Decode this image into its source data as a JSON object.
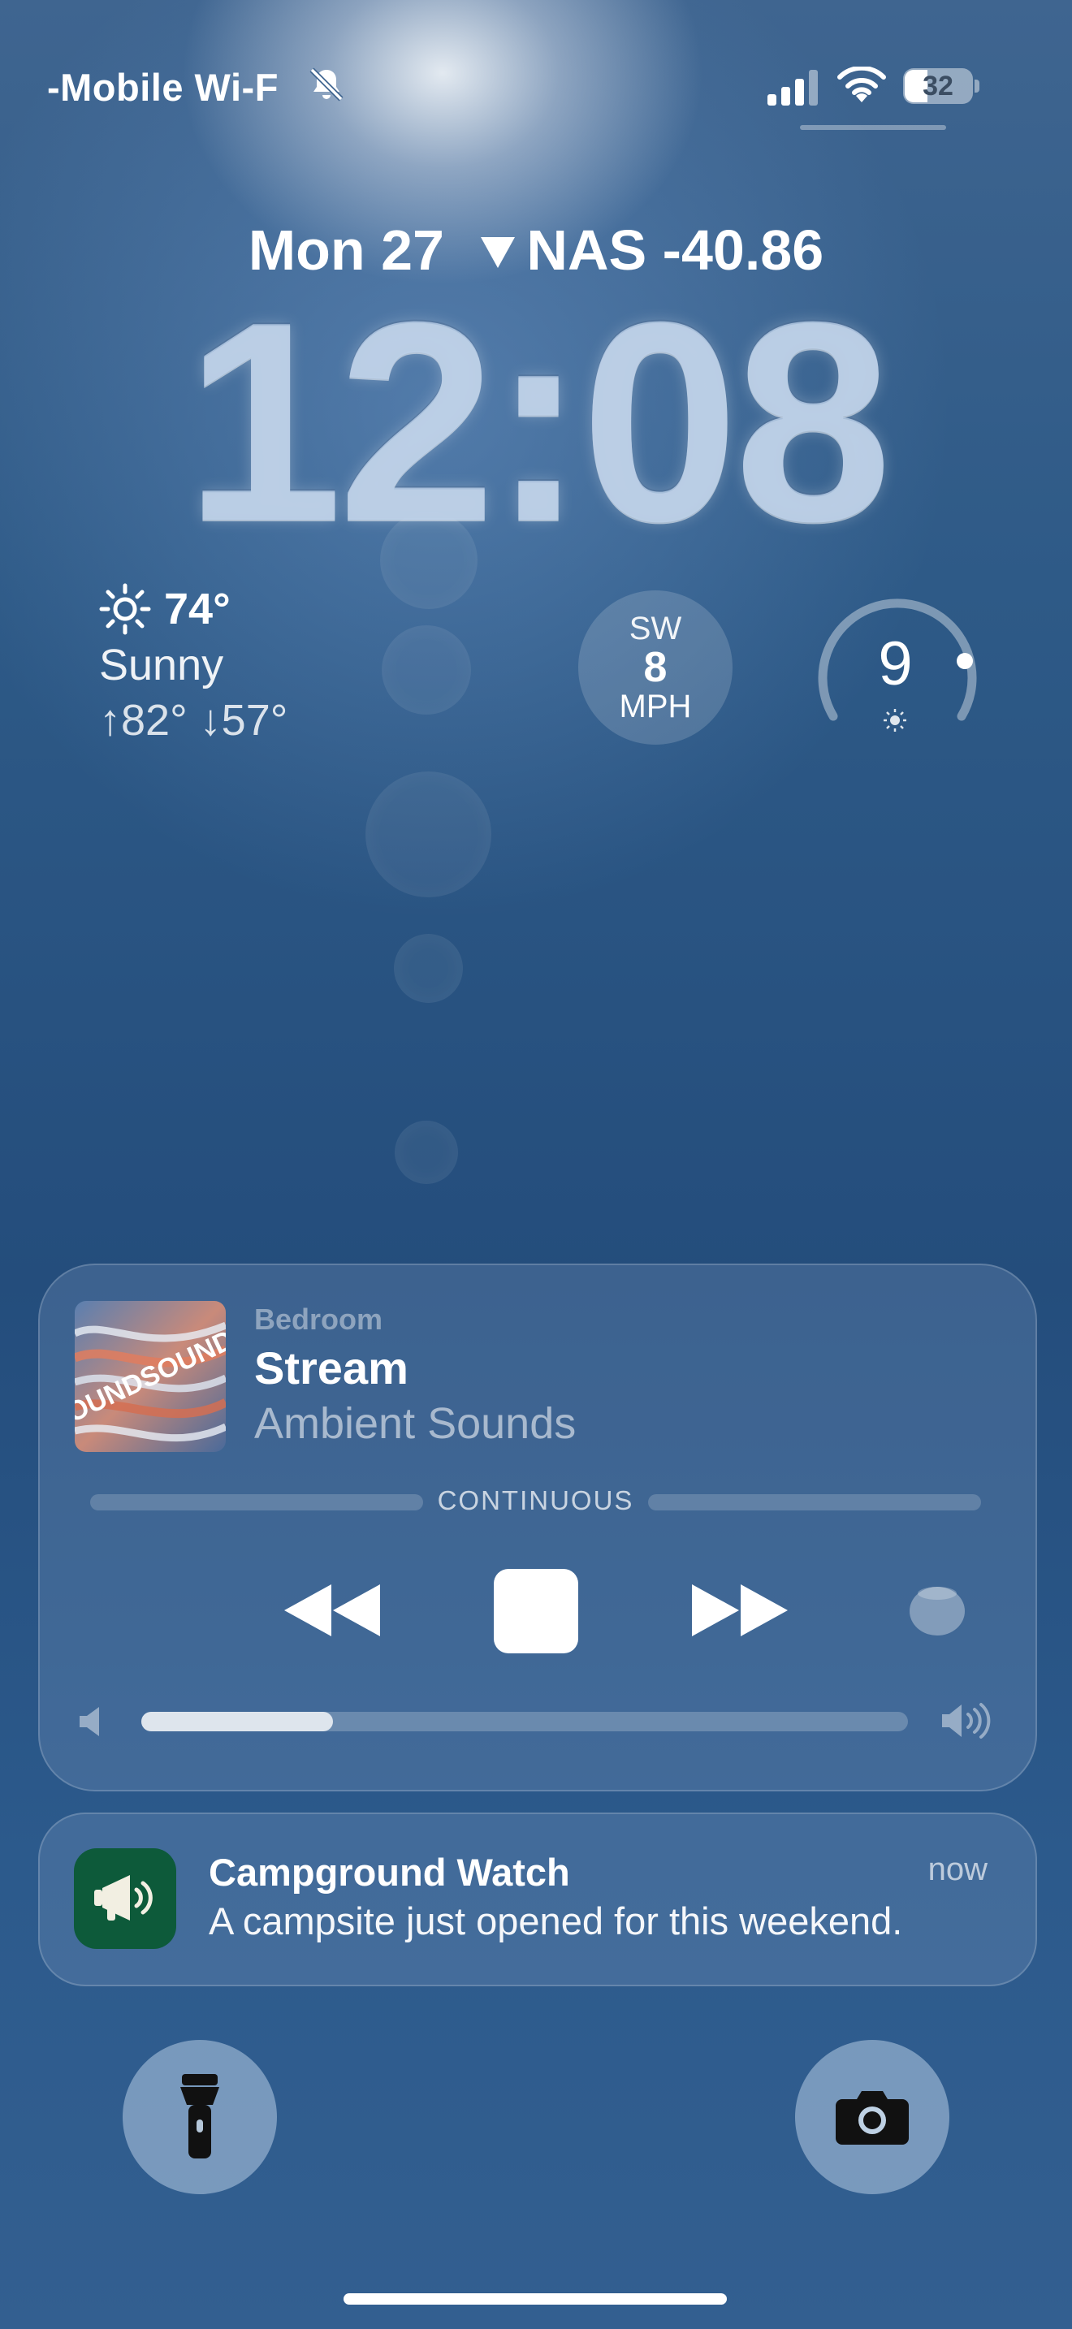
{
  "status_bar": {
    "carrier": "-Mobile Wi-F",
    "battery": "32",
    "icons": [
      "silent-mode-bell-icon",
      "cellular-signal-icon",
      "wifi-icon",
      "battery-icon"
    ]
  },
  "lock_screen": {
    "date": "Mon 27",
    "stock": {
      "symbol": "NAS",
      "change": "-40.86",
      "direction_icon": "down-triangle-icon"
    },
    "time": "12:08"
  },
  "widgets": {
    "weather": {
      "icon": "sun-icon",
      "temperature": "74°",
      "condition": "Sunny",
      "range": "↑82° ↓57°"
    },
    "wind": {
      "direction": "SW",
      "speed": "8",
      "unit": "MPH"
    },
    "uv_index": {
      "value": "9",
      "icon": "sun-small-icon",
      "level_fraction": 0.82
    }
  },
  "now_playing": {
    "room": "Bedroom",
    "title": "Stream",
    "artist": "Ambient Sounds",
    "mode": "CONTINUOUS",
    "album_art_text": "SOUNDSOUNDS",
    "volume_fraction": 0.25,
    "controls": [
      "rewind-icon",
      "stop-icon",
      "fast-forward-icon",
      "homepod-icon"
    ]
  },
  "notification": {
    "app": "Campground Watch",
    "time": "now",
    "message": "A campsite just opened for this weekend.",
    "icon": "megaphone-icon",
    "icon_color": "#0d5a3a"
  },
  "quick_actions": [
    "flashlight-icon",
    "camera-icon"
  ]
}
